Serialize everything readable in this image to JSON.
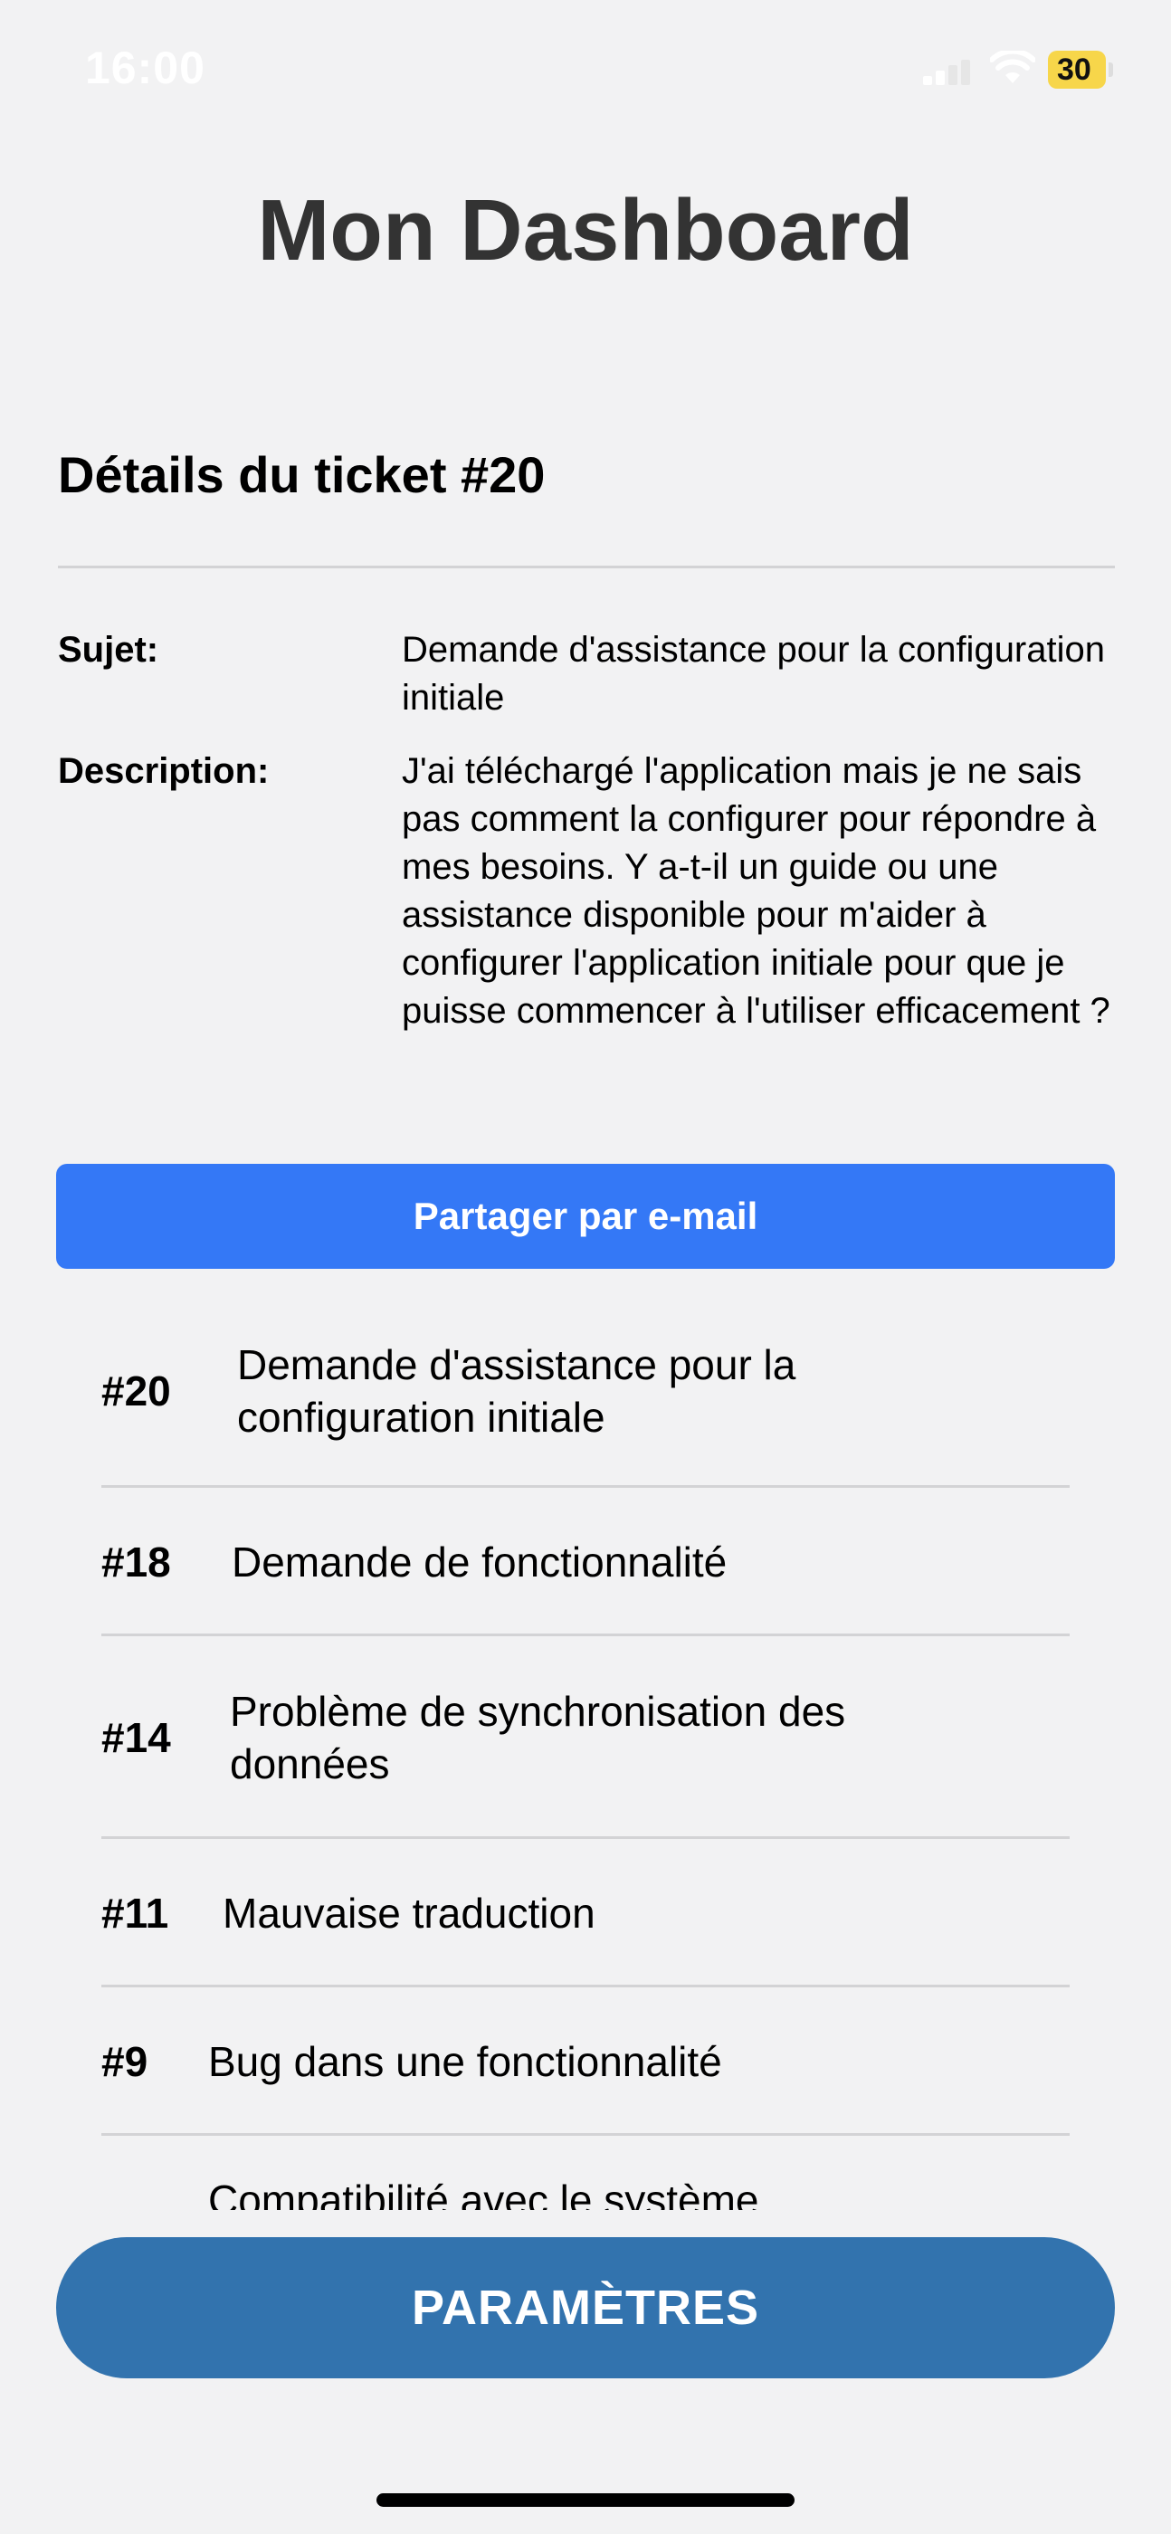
{
  "status_bar": {
    "time": "16:00",
    "battery_level": "30",
    "battery_color": "#f7d64a",
    "icons": [
      "signal-icon",
      "wifi-icon",
      "battery-icon"
    ]
  },
  "page": {
    "title": "Mon Dashboard"
  },
  "details": {
    "title": "Détails du ticket #20",
    "subject_label": "Sujet:",
    "subject_value": "Demande d'assistance pour la configuration initiale",
    "description_label": "Description:",
    "description_value": "J'ai téléchargé l'application mais je ne sais pas comment la configurer pour répondre à mes besoins. Y a-t-il un guide ou une assistance disponible pour m'aider à configurer l'application initiale pour que je puisse commencer à l'utiliser efficacement ?",
    "share_button_label": "Partager par e-mail"
  },
  "tickets": [
    {
      "id": "#20",
      "subject": "Demande d'assistance pour la configuration initiale"
    },
    {
      "id": "#18",
      "subject": "Demande de fonctionnalité"
    },
    {
      "id": "#14",
      "subject": "Problème de synchronisation des données"
    },
    {
      "id": "#11",
      "subject": "Mauvaise traduction"
    },
    {
      "id": "#9",
      "subject": "Bug dans une fonctionnalité"
    },
    {
      "id": "",
      "subject": "Compatibilité avec le système"
    }
  ],
  "settings_button_label": "PARAMÈTRES",
  "colors": {
    "background": "#f2f2f3",
    "title": "#333333",
    "share_button": "#3478f6",
    "settings_button": "#3273ae"
  }
}
